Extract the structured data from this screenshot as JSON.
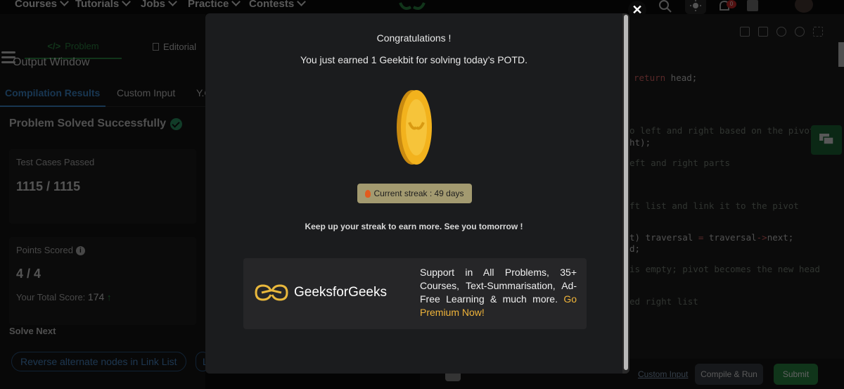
{
  "nav": {
    "items": [
      {
        "label": "Courses"
      },
      {
        "label": "Tutorials"
      },
      {
        "label": "Jobs"
      },
      {
        "label": "Practice"
      },
      {
        "label": "Contests"
      }
    ],
    "notification_count": "0"
  },
  "left_panel": {
    "tabs": [
      {
        "label": "Problem",
        "icon": "code-icon"
      },
      {
        "label": "Editorial",
        "icon": "document-icon"
      }
    ],
    "output_title": "Output Window",
    "subtabs": [
      {
        "label": "Compilation Results"
      },
      {
        "label": "Custom Input"
      },
      {
        "label": "Y.O"
      }
    ],
    "status": "Problem Solved Successfully",
    "test_cases": {
      "label": "Test Cases Passed",
      "value": "1115 / 1115"
    },
    "points": {
      "label": "Points Scored",
      "value": "4 / 4",
      "total_label": "Your Total Score:",
      "total_value": "174"
    },
    "solve_next": {
      "label": "Solve Next",
      "items": [
        {
          "label": "Reverse alternate nodes in Link List"
        },
        {
          "label": "L"
        }
      ]
    }
  },
  "editor": {
    "code_lines": [
      {
        "pre": "",
        "kw": "return",
        "post": " head;"
      },
      {
        "comment": "o left and right based on the pivot"
      },
      {
        "plain": "ht);"
      },
      {
        "comment": "eft and right parts"
      },
      {
        "comment": "ft list and link it to the pivot"
      },
      {
        "plain_pre": "t) traversal ",
        "op": "=",
        "plain_post": " traversal",
        "op2": "->",
        "tail": "next;"
      },
      {
        "plain": "d;"
      },
      {
        "comment": "is empty; pivot becomes the new head"
      },
      {
        "comment": "ed right list"
      }
    ],
    "custom_input_label": "Custom Input",
    "compile_label": "Compile & Run",
    "submit_label": "Submit"
  },
  "modal": {
    "title": "Congratulations !",
    "subtitle": "You just earned 1 Geekbit for solving today’s POTD.",
    "streak": "Current streak : 49 days",
    "keep_up": "Keep up your streak to earn more. See you tomorrow !",
    "premium_brand": "GeeksforGeeks",
    "premium_text": "Support in All Problems, 35+ Courses, Text-Summarisation, Ad-Free Learning & much more.",
    "premium_link": "Go Premium Now!"
  },
  "colors": {
    "brand_green": "#2f8d46",
    "coin_gold": "#f2b21d",
    "link_blue": "#4d8fd0",
    "premium_link": "#f0b43a",
    "streak_bg": "#a39a70"
  }
}
